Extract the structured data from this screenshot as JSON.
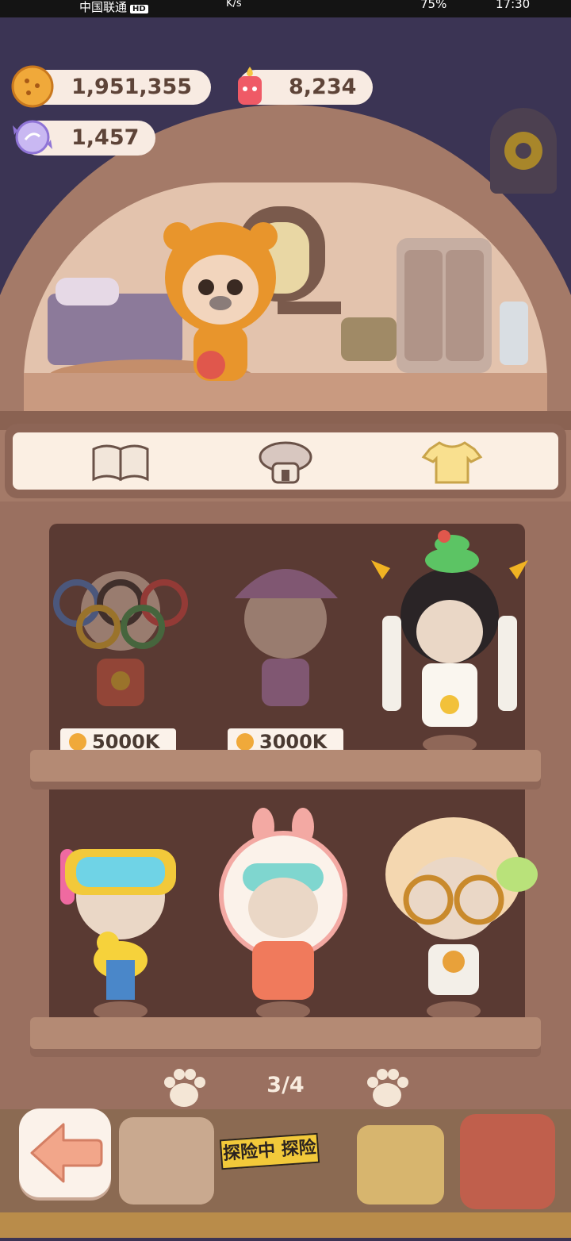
{
  "status_bar": {
    "carrier": "中国联通",
    "hd": "HD",
    "speed": "K/s",
    "battery": "75%",
    "time": "17:30"
  },
  "currency": {
    "coins": "1,951,355",
    "gems": "8,234",
    "crystals": "1,457"
  },
  "tabs": [
    {
      "name": "book-tab"
    },
    {
      "name": "hotel-tab"
    },
    {
      "name": "outfit-tab"
    }
  ],
  "outfits": {
    "row1": [
      {
        "name": "olympic-rings-outfit",
        "price": "5000K",
        "locked": true
      },
      {
        "name": "ok-beanie-outfit",
        "price": "3000K",
        "locked": true
      },
      {
        "name": "snake-empress-outfit",
        "locked": false
      }
    ],
    "row2": [
      {
        "name": "snorkel-duck-outfit",
        "locked": false
      },
      {
        "name": "bunny-astronaut-outfit",
        "locked": false
      },
      {
        "name": "explorer-glasses-outfit",
        "locked": false
      }
    ]
  },
  "pager": {
    "label": "3/4"
  },
  "bottom_banner": "探险中 探险",
  "colors": {
    "background": "#3b3454",
    "wood": "#9a7060",
    "cabinet_inner": "#5a3a33",
    "cream": "#fbf2ea"
  }
}
